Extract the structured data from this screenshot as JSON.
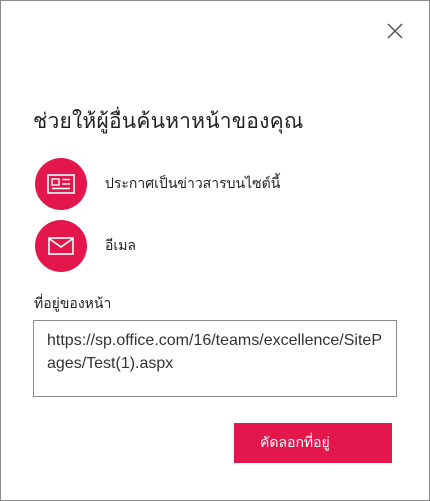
{
  "dialog": {
    "title": "ช่วยให้ผู้อื่นค้นหาหน้าของคุณ",
    "close_icon": "close-icon",
    "accent_color": "#e4174c"
  },
  "options": [
    {
      "label": "ประกาศเป็นข่าวสารบนไซต์นี้",
      "icon": "news-icon"
    },
    {
      "label": "อีเมล",
      "icon": "mail-icon"
    }
  ],
  "address": {
    "label": "ที่อยู่ของหน้า",
    "value": "https://sp.office.com/16/teams/excellence/SitePages/Test(1).aspx"
  },
  "copy_button": {
    "label": "คัดลอกที่อยู่"
  }
}
